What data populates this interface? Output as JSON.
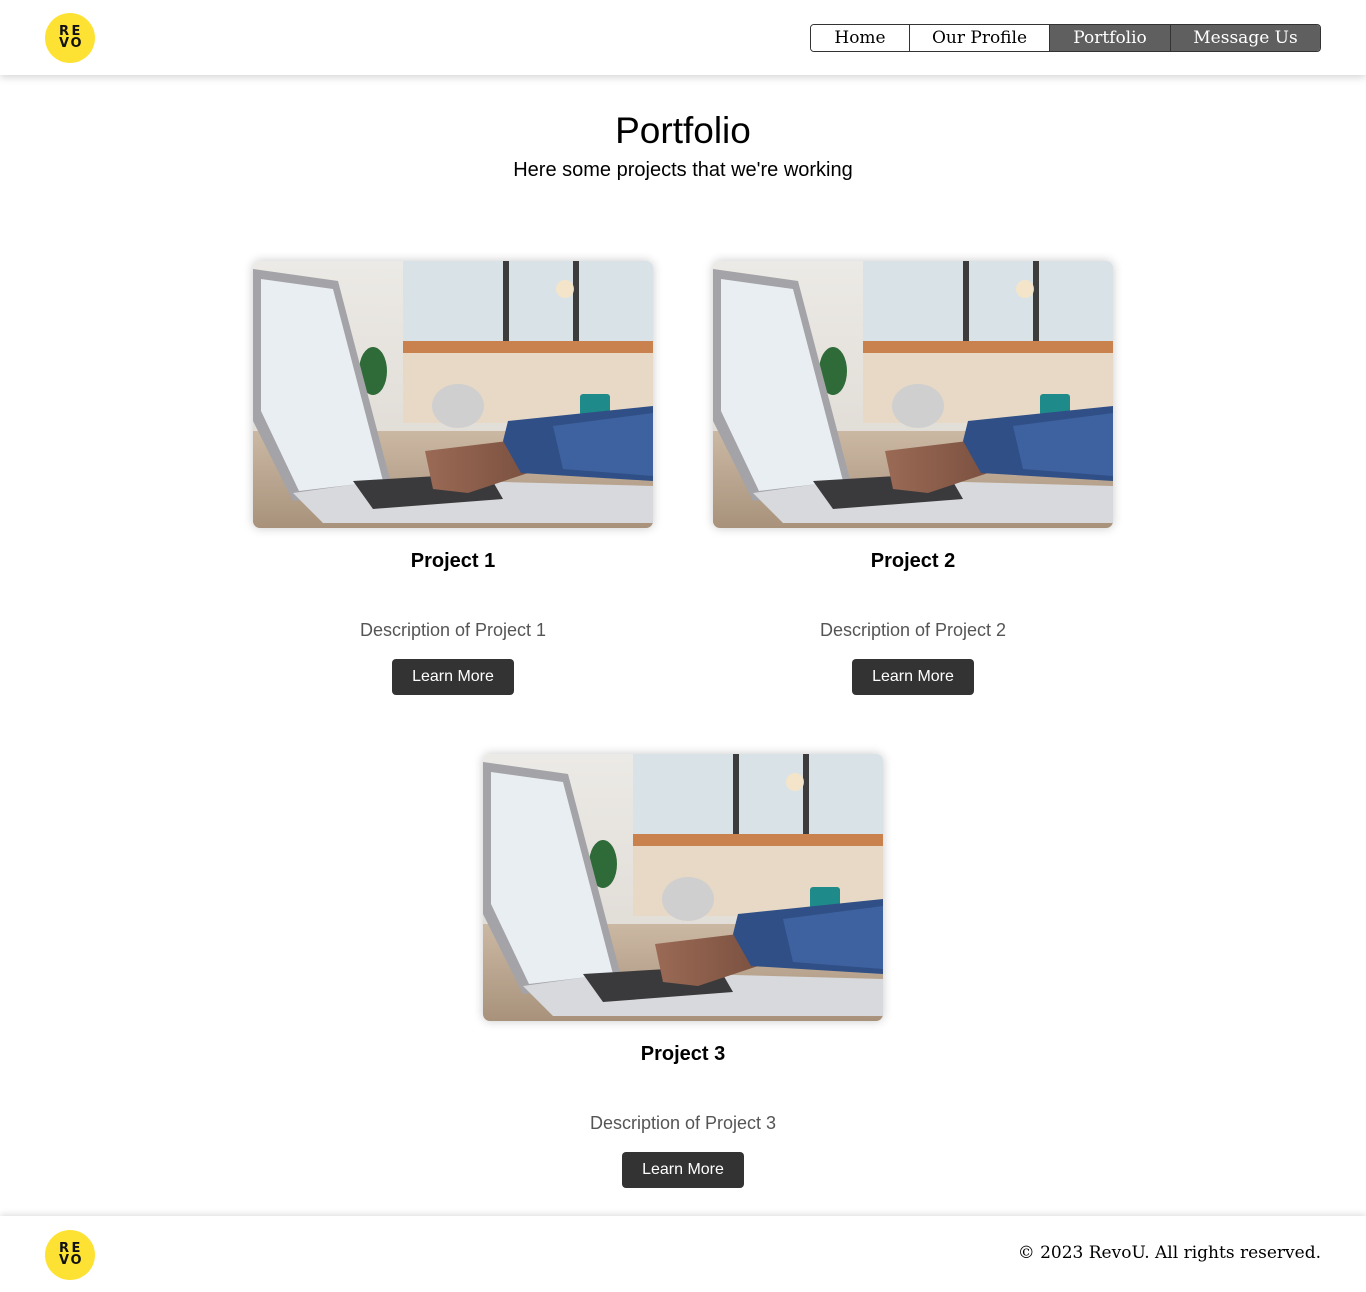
{
  "brand": {
    "logo_letters": [
      "R",
      "E",
      "V",
      "O"
    ],
    "logo_color": "#fde234"
  },
  "nav": {
    "items": [
      {
        "label": "Home",
        "active": false
      },
      {
        "label": "Our Profile",
        "active": false
      },
      {
        "label": "Portfolio",
        "active": true
      },
      {
        "label": "Message Us",
        "active": true
      }
    ]
  },
  "hero": {
    "title": "Portfolio",
    "subtitle": "Here some projects that we're working"
  },
  "projects": [
    {
      "title": "Project 1",
      "description": "Description of Project 1",
      "button_label": "Learn More",
      "image": "laptop-typing-photo"
    },
    {
      "title": "Project 2",
      "description": "Description of Project 2",
      "button_label": "Learn More",
      "image": "laptop-typing-photo"
    },
    {
      "title": "Project 3",
      "description": "Description of Project 3",
      "button_label": "Learn More",
      "image": "laptop-typing-photo"
    }
  ],
  "footer": {
    "copyright": "© 2023 RevoU. All rights reserved."
  },
  "colors": {
    "nav_active_bg": "#5f5f5f",
    "button_bg": "#333333",
    "description_text": "#555555"
  }
}
